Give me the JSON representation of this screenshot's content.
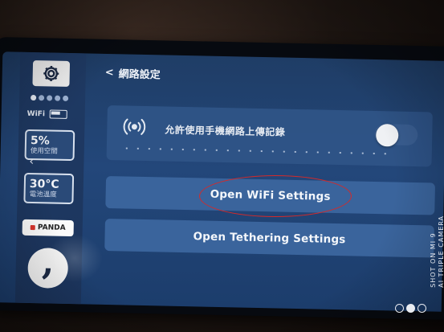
{
  "sidebar": {
    "wifi_label": "WiFi",
    "storage": {
      "value": "5%",
      "label": "使用空間"
    },
    "temperature": {
      "value": "30°C",
      "label": "電池溫度"
    },
    "panda_label": "PANDA",
    "comma_glyph": ","
  },
  "header": {
    "back_symbol": "<",
    "title": "網路設定"
  },
  "upload_toggle": {
    "label": "允許使用手機網路上傳記錄",
    "enabled": false
  },
  "buttons": {
    "open_wifi": "Open WiFi Settings",
    "open_tethering": "Open Tethering Settings"
  },
  "watermark": {
    "line1": "SHOT ON MI 9",
    "line2": "AI TRIPLE CAMERA"
  },
  "colors": {
    "screen_bg": "#23477a",
    "button_bg": "#3a649c",
    "annotation": "#d42a2a"
  },
  "icons": {
    "settings": "gear-icon",
    "signal": "wireless-signal-icon",
    "back": "chevron-left-icon"
  }
}
